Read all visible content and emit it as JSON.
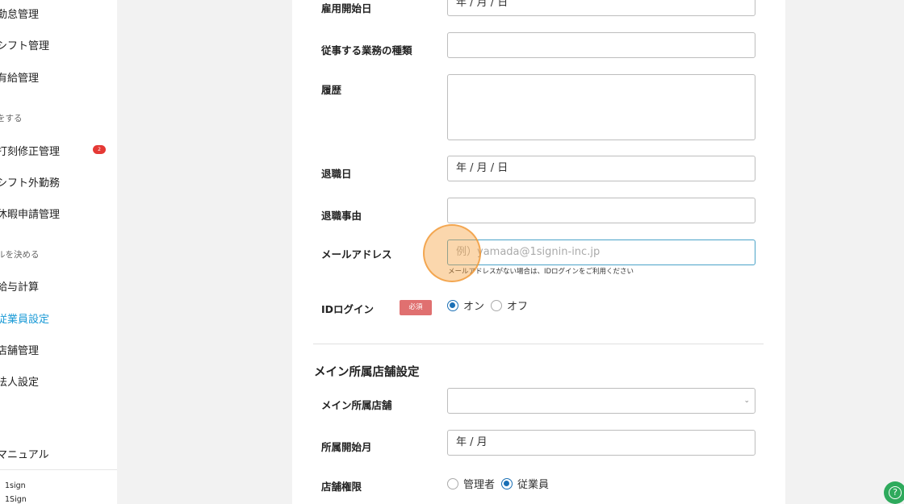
{
  "sidebar": {
    "items": [
      {
        "label": "勤怠管理"
      },
      {
        "label": "シフト管理"
      },
      {
        "label": "有給管理"
      },
      {
        "label": "打刻修正管理",
        "badge": "2"
      },
      {
        "label": "シフト外勤務"
      },
      {
        "label": "休暇申請管理"
      },
      {
        "label": "給与計算"
      },
      {
        "label": "従業員設定",
        "active": true
      },
      {
        "label": "店舗管理"
      },
      {
        "label": "法人設定"
      },
      {
        "label": "マニュアル"
      }
    ],
    "sections": [
      "をする",
      "ルを決める"
    ],
    "footer": {
      "line1": "1sign",
      "line2": "1Sign"
    }
  },
  "form": {
    "employment_start": {
      "label": "雇用開始日",
      "value": "年 / 月 / 日"
    },
    "job_type": {
      "label": "従事する業務の種類",
      "value": ""
    },
    "history": {
      "label": "履歴",
      "value": ""
    },
    "retirement_date": {
      "label": "退職日",
      "value": "年 / 月 / 日"
    },
    "retirement_reason": {
      "label": "退職事由",
      "value": ""
    },
    "email": {
      "label": "メールアドレス",
      "placeholder": "例）yamada@1signin-inc.jp",
      "hint": "メールアドレスがない場合は、IDログインをご利用ください"
    },
    "id_login": {
      "label": "IDログイン",
      "required": "必須",
      "options": [
        "オン",
        "オフ"
      ],
      "selected": "オン"
    }
  },
  "store_section": {
    "title": "メイン所属店舗設定",
    "main_store": {
      "label": "メイン所属店舗",
      "value": ""
    },
    "start_month": {
      "label": "所属開始月",
      "value": "年 / 月"
    },
    "permission": {
      "label": "店舗権限",
      "options": [
        "管理者",
        "従業員"
      ],
      "selected": "従業員"
    }
  },
  "help": {
    "label": "?"
  },
  "colors": {
    "accent": "#1a9ad6",
    "required_badge": "#e07070",
    "help_button": "#2eaa5c",
    "badge": "#e53935"
  }
}
